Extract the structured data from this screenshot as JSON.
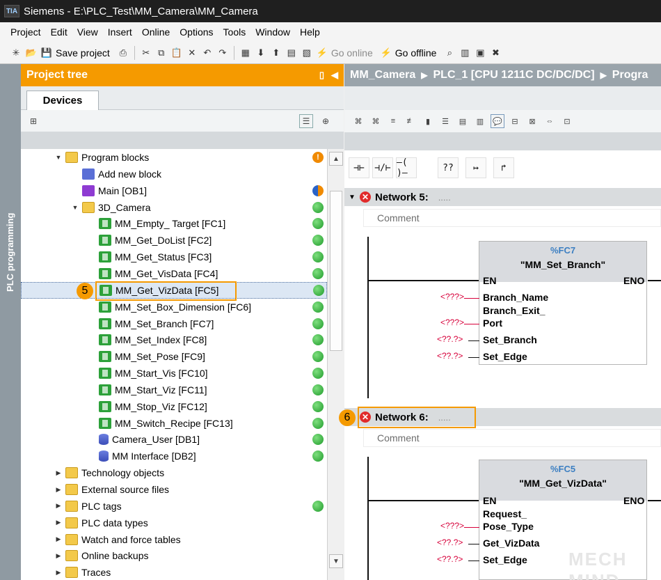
{
  "window": {
    "logo_text": "TIA",
    "title": "Siemens - E:\\PLC_Test\\MM_Camera\\MM_Camera"
  },
  "menu": [
    "Project",
    "Edit",
    "View",
    "Insert",
    "Online",
    "Options",
    "Tools",
    "Window",
    "Help"
  ],
  "toolbar": {
    "save_label": "Save project",
    "go_online_label": "Go online",
    "go_offline_label": "Go offline"
  },
  "side_strip": {
    "label": "PLC programming"
  },
  "project_tree": {
    "header": "Project tree",
    "tab": "Devices",
    "items": [
      {
        "label": "Program blocks",
        "level": 0,
        "arrow": "▼",
        "icon": "folder-icon",
        "status": "warning"
      },
      {
        "label": "Add new block",
        "level": 1,
        "arrow": "",
        "icon": "add-block-icon",
        "status": ""
      },
      {
        "label": "Main [OB1]",
        "level": 1,
        "arrow": "",
        "icon": "ob-icon",
        "status": "mixed"
      },
      {
        "label": "3D_Camera",
        "level": 1,
        "arrow": "▼",
        "icon": "folder-icon",
        "status": "green"
      },
      {
        "label": "MM_Empty_ Target [FC1]",
        "level": 2,
        "arrow": "",
        "icon": "fc-icon",
        "status": "green"
      },
      {
        "label": "MM_Get_DoList [FC2]",
        "level": 2,
        "arrow": "",
        "icon": "fc-icon",
        "status": "green"
      },
      {
        "label": "MM_Get_Status [FC3]",
        "level": 2,
        "arrow": "",
        "icon": "fc-icon",
        "status": "green"
      },
      {
        "label": "MM_Get_VisData [FC4]",
        "level": 2,
        "arrow": "",
        "icon": "fc-icon",
        "status": "green"
      },
      {
        "label": "MM_Get_VizData [FC5]",
        "level": 2,
        "arrow": "",
        "icon": "fc-icon",
        "status": "green",
        "selected": true
      },
      {
        "label": "MM_Set_Box_Dimension [FC6]",
        "level": 2,
        "arrow": "",
        "icon": "fc-icon",
        "status": "green"
      },
      {
        "label": "MM_Set_Branch [FC7]",
        "level": 2,
        "arrow": "",
        "icon": "fc-icon",
        "status": "green"
      },
      {
        "label": "MM_Set_Index [FC8]",
        "level": 2,
        "arrow": "",
        "icon": "fc-icon",
        "status": "green"
      },
      {
        "label": "MM_Set_Pose [FC9]",
        "level": 2,
        "arrow": "",
        "icon": "fc-icon",
        "status": "green"
      },
      {
        "label": "MM_Start_Vis [FC10]",
        "level": 2,
        "arrow": "",
        "icon": "fc-icon",
        "status": "green"
      },
      {
        "label": "MM_Start_Viz [FC11]",
        "level": 2,
        "arrow": "",
        "icon": "fc-icon",
        "status": "green"
      },
      {
        "label": "MM_Stop_Viz [FC12]",
        "level": 2,
        "arrow": "",
        "icon": "fc-icon",
        "status": "green"
      },
      {
        "label": "MM_Switch_Recipe [FC13]",
        "level": 2,
        "arrow": "",
        "icon": "fc-icon",
        "status": "green"
      },
      {
        "label": "Camera_User [DB1]",
        "level": 2,
        "arrow": "",
        "icon": "db-icon",
        "status": "green"
      },
      {
        "label": "MM Interface [DB2]",
        "level": 2,
        "arrow": "",
        "icon": "db-icon",
        "status": "green"
      },
      {
        "label": "Technology objects",
        "level": 0,
        "arrow": "▶",
        "icon": "folder-icon",
        "status": ""
      },
      {
        "label": "External source files",
        "level": 0,
        "arrow": "▶",
        "icon": "folder-icon",
        "status": ""
      },
      {
        "label": "PLC tags",
        "level": 0,
        "arrow": "▶",
        "icon": "folder-icon",
        "status": "green"
      },
      {
        "label": "PLC data types",
        "level": 0,
        "arrow": "▶",
        "icon": "folder-icon",
        "status": ""
      },
      {
        "label": "Watch and force tables",
        "level": 0,
        "arrow": "▶",
        "icon": "folder-icon",
        "status": ""
      },
      {
        "label": "Online backups",
        "level": 0,
        "arrow": "▶",
        "icon": "folder-icon",
        "status": ""
      },
      {
        "label": "Traces",
        "level": 0,
        "arrow": "▶",
        "icon": "folder-icon",
        "status": ""
      }
    ]
  },
  "editor": {
    "breadcrumb": [
      "MM_Camera",
      "PLC_1 [CPU 1211C DC/DC/DC]",
      "Progra"
    ],
    "ladder_buttons": [
      "⊣⊢",
      "⊣/⊢",
      "–( )–",
      "??",
      "↦",
      "↱"
    ],
    "networks": [
      {
        "title": "Network 5:",
        "dots": ".....",
        "comment": "Comment",
        "block_number": "%FC7",
        "block_name": "\"MM_Set_Branch\"",
        "en": "EN",
        "eno": "ENO",
        "pins": [
          {
            "label": "Branch_Name",
            "value": "<???>"
          },
          {
            "label": "Branch_Exit_",
            "value": ""
          },
          {
            "label": "Port",
            "value": "<???>"
          },
          {
            "label": "Set_Branch",
            "value": "<??.?>"
          },
          {
            "label": "Set_Edge",
            "value": "<??.?>"
          }
        ]
      },
      {
        "title": "Network 6:",
        "dots": ".....",
        "comment": "Comment",
        "block_number": "%FC5",
        "block_name": "\"MM_Get_VizData\"",
        "en": "EN",
        "eno": "ENO",
        "pins": [
          {
            "label": "Request_",
            "value": ""
          },
          {
            "label": "Pose_Type",
            "value": "<???>"
          },
          {
            "label": "Get_VizData",
            "value": "<??.?>"
          },
          {
            "label": "Set_Edge",
            "value": "<??.?>"
          }
        ]
      }
    ]
  },
  "callouts": {
    "step5": "5",
    "step6": "6"
  },
  "watermark": "MECH MIND",
  "colors": {
    "accent_orange": "#f59a00",
    "status_green": "#1e9a2a",
    "error_red": "#e12b2b",
    "fc_blue": "#3c7fc2"
  }
}
